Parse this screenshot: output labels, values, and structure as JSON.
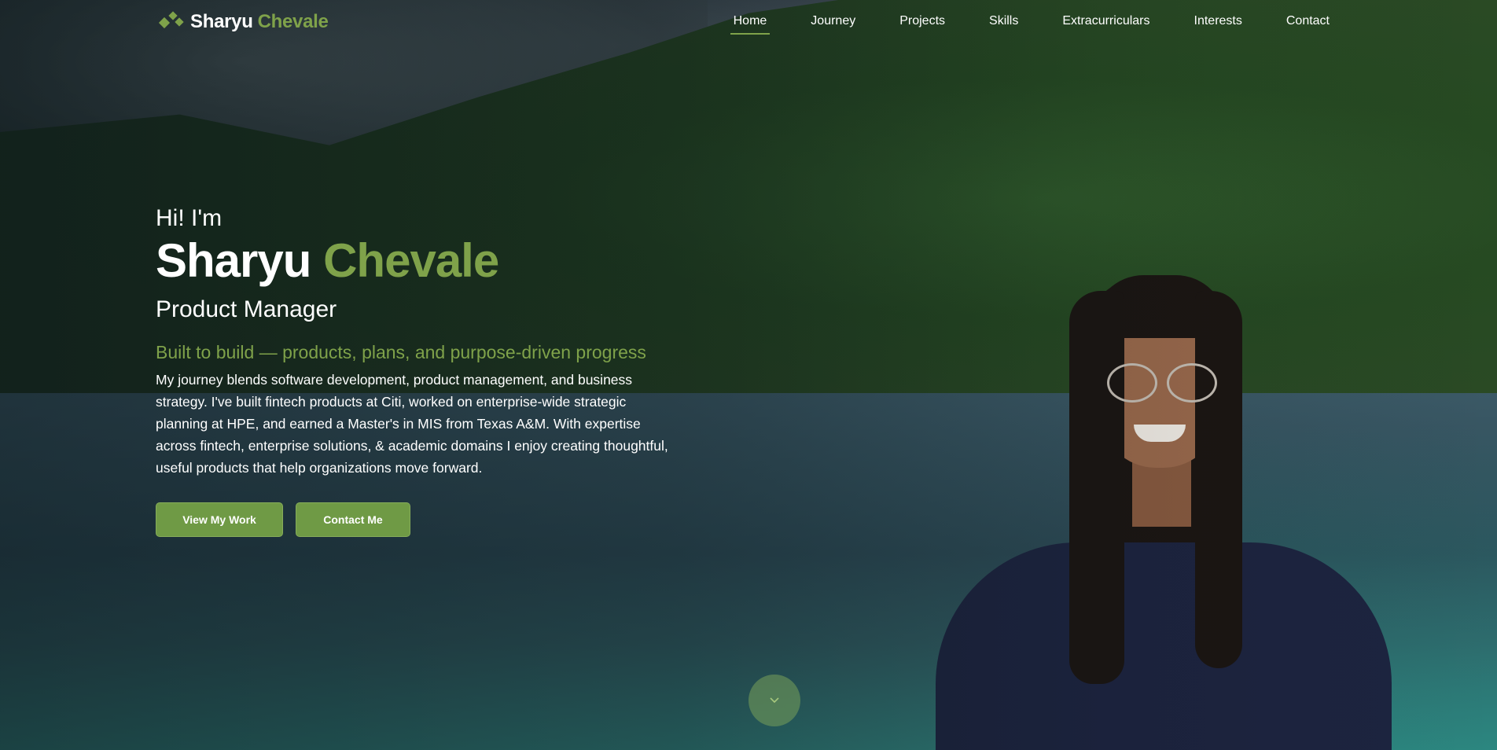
{
  "nav": {
    "logo": {
      "first": "Sharyu",
      "last": "Chevale",
      "icon": "diamond-sparkle-icon"
    },
    "items": [
      {
        "label": "Home",
        "active": true
      },
      {
        "label": "Journey",
        "active": false
      },
      {
        "label": "Projects",
        "active": false
      },
      {
        "label": "Skills",
        "active": false
      },
      {
        "label": "Extracurriculars",
        "active": false
      },
      {
        "label": "Interests",
        "active": false
      },
      {
        "label": "Contact",
        "active": false
      }
    ]
  },
  "hero": {
    "greeting": "Hi! I'm",
    "first_name": "Sharyu",
    "last_name": "Chevale",
    "role": "Product Manager",
    "tagline": "Built to build — products, plans, and purpose-driven progress",
    "bio": "My journey blends software development, product management, and business strategy. I've built fintech products at Citi, worked on enterprise-wide strategic planning at HPE, and earned a Master's in MIS from Texas A&M. With expertise across fintech, enterprise solutions, & academic domains I enjoy creating thoughtful, useful products that help organizations move forward.",
    "buttons": {
      "work": "View My Work",
      "contact": "Contact Me"
    },
    "scroll_icon": "chevron-down-icon"
  },
  "colors": {
    "accent": "#7fa24a",
    "button": "#6f9a45",
    "text": "#ffffff"
  }
}
